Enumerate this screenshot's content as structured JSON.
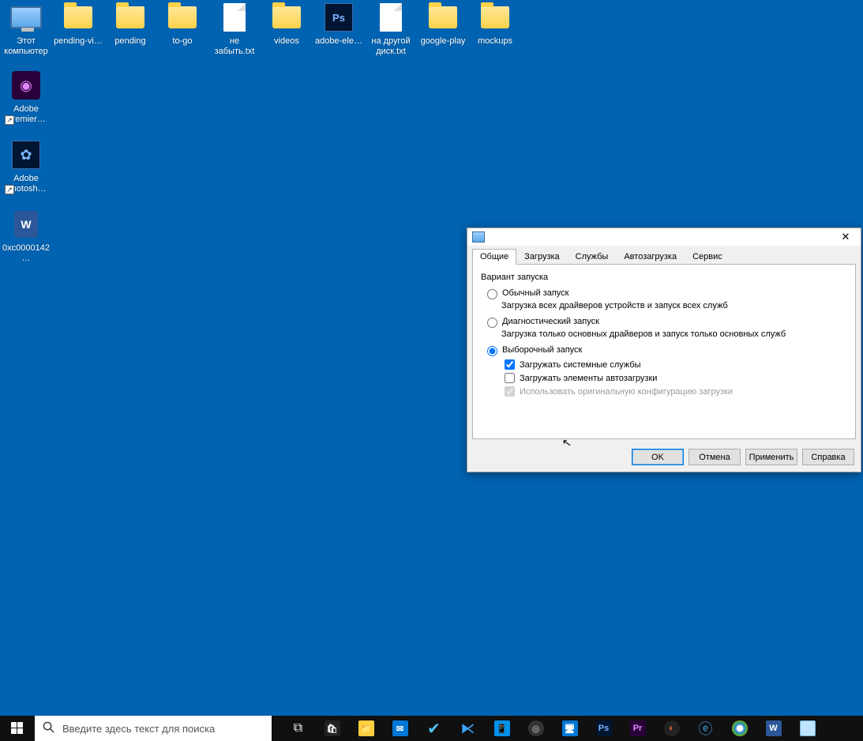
{
  "desktop": {
    "icons": [
      {
        "id": "this-pc",
        "label": "Этот компьютер"
      },
      {
        "id": "pending-vi",
        "label": "pending-vi…"
      },
      {
        "id": "pending",
        "label": "pending"
      },
      {
        "id": "to-go",
        "label": "to-go"
      },
      {
        "id": "ne-zabyt",
        "label": "не забыть.txt"
      },
      {
        "id": "videos",
        "label": "videos"
      },
      {
        "id": "adobe-ele",
        "label": "adobe-ele…"
      },
      {
        "id": "na-drugoy",
        "label": "на другой диск.txt"
      },
      {
        "id": "google-play",
        "label": "google-play"
      },
      {
        "id": "mockups",
        "label": "mockups"
      },
      {
        "id": "adobe-premier",
        "label": "Adobe Premier…"
      },
      {
        "id": "adobe-photosh",
        "label": "Adobe Photosh…"
      },
      {
        "id": "0xc0000142",
        "label": "0xc0000142…"
      }
    ]
  },
  "dialog": {
    "tabs": [
      "Общие",
      "Загрузка",
      "Службы",
      "Автозагрузка",
      "Сервис"
    ],
    "active_tab": 0,
    "group_title": "Вариант запуска",
    "options": [
      {
        "label": "Обычный запуск",
        "desc": "Загрузка всех драйверов устройств и запуск всех служб",
        "selected": false
      },
      {
        "label": "Диагностический запуск",
        "desc": "Загрузка только основных драйверов и запуск только основных служб",
        "selected": false
      },
      {
        "label": "Выборочный запуск",
        "desc": "",
        "selected": true
      }
    ],
    "subchecks": [
      {
        "label": "Загружать системные службы",
        "checked": true,
        "disabled": false
      },
      {
        "label": "Загружать элементы автозагрузки",
        "checked": false,
        "disabled": false
      },
      {
        "label": "Использовать оригинальную конфигурацию загрузки",
        "checked": true,
        "disabled": true
      }
    ],
    "buttons": {
      "ok": "OK",
      "cancel": "Отмена",
      "apply": "Применить",
      "help": "Справка"
    }
  },
  "taskbar": {
    "search_placeholder": "Введите здесь текст для поиска",
    "apps": [
      "task-view",
      "store",
      "explorer",
      "mail",
      "todo",
      "vscode",
      "phone",
      "obs",
      "remote",
      "photoshop",
      "premiere",
      "davinci",
      "edge",
      "chrome",
      "word",
      "msconfig"
    ]
  }
}
